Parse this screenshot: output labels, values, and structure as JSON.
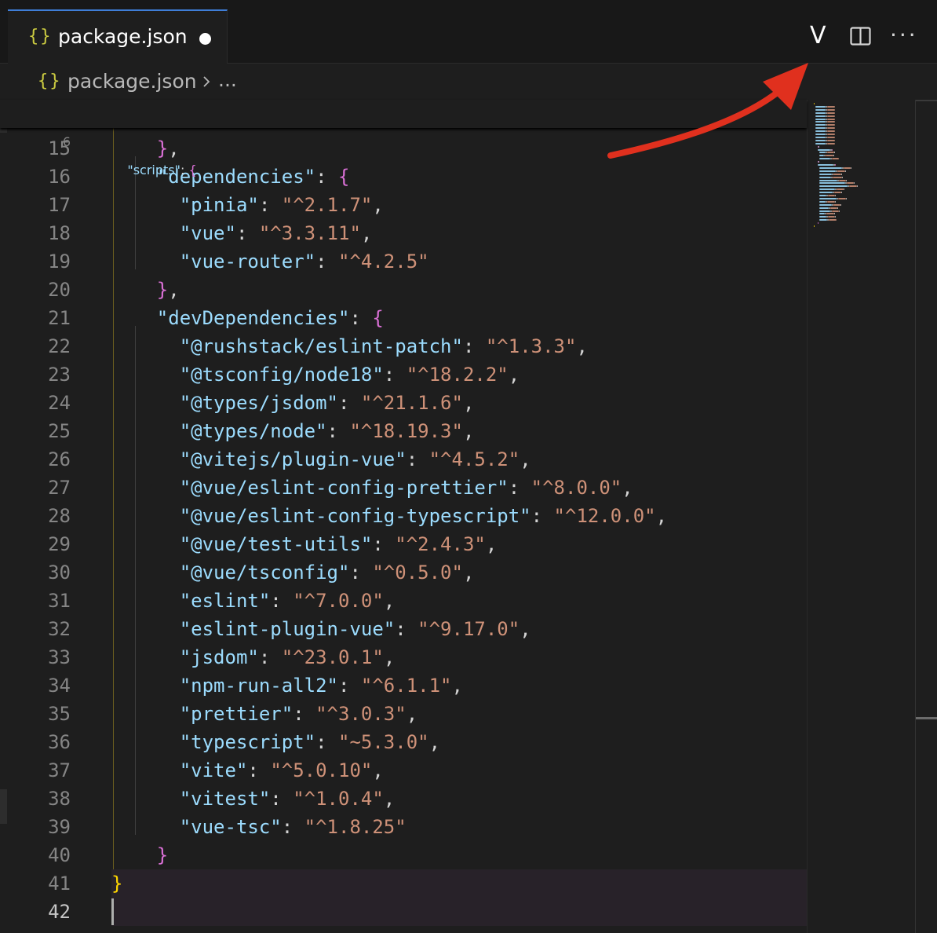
{
  "tab": {
    "icon": "{}",
    "label": "package.json",
    "dirty": true
  },
  "actions": {
    "v_label": "V",
    "split_icon": "split-editor-icon",
    "more_label": "···"
  },
  "breadcrumb": {
    "icon": "{}",
    "file": "package.json",
    "ellipsis": "..."
  },
  "colors": {
    "key": "#9cdcfe",
    "string": "#ce9178",
    "punct": "#d4d4d4",
    "bracket_level1": "#ffd700",
    "bracket_level2": "#da70d6",
    "bracket_level3": "#179fff",
    "annotation_arrow": "#e0301e",
    "tab_accent": "#3f7ed8"
  },
  "sticky_line": {
    "num": "6",
    "tokens": [
      {
        "t": "    ",
        "c": "p"
      },
      {
        "t": "\"scripts\"",
        "c": "k"
      },
      {
        "t": ": ",
        "c": "p"
      },
      {
        "t": "{",
        "c": "b2"
      }
    ]
  },
  "lines": [
    {
      "num": "15",
      "tokens": [
        {
          "t": "    ",
          "c": "p"
        },
        {
          "t": "}",
          "c": "b2"
        },
        {
          "t": ",",
          "c": "p"
        }
      ]
    },
    {
      "num": "16",
      "tokens": [
        {
          "t": "    ",
          "c": "p"
        },
        {
          "t": "\"dependencies\"",
          "c": "k"
        },
        {
          "t": ": ",
          "c": "p"
        },
        {
          "t": "{",
          "c": "b2"
        }
      ]
    },
    {
      "num": "17",
      "tokens": [
        {
          "t": "      ",
          "c": "p"
        },
        {
          "t": "\"pinia\"",
          "c": "k"
        },
        {
          "t": ": ",
          "c": "p"
        },
        {
          "t": "\"^2.1.7\"",
          "c": "s"
        },
        {
          "t": ",",
          "c": "p"
        }
      ]
    },
    {
      "num": "18",
      "tokens": [
        {
          "t": "      ",
          "c": "p"
        },
        {
          "t": "\"vue\"",
          "c": "k"
        },
        {
          "t": ": ",
          "c": "p"
        },
        {
          "t": "\"^3.3.11\"",
          "c": "s"
        },
        {
          "t": ",",
          "c": "p"
        }
      ]
    },
    {
      "num": "19",
      "tokens": [
        {
          "t": "      ",
          "c": "p"
        },
        {
          "t": "\"vue-router\"",
          "c": "k"
        },
        {
          "t": ": ",
          "c": "p"
        },
        {
          "t": "\"^4.2.5\"",
          "c": "s"
        }
      ]
    },
    {
      "num": "20",
      "tokens": [
        {
          "t": "    ",
          "c": "p"
        },
        {
          "t": "}",
          "c": "b2"
        },
        {
          "t": ",",
          "c": "p"
        }
      ]
    },
    {
      "num": "21",
      "tokens": [
        {
          "t": "    ",
          "c": "p"
        },
        {
          "t": "\"devDependencies\"",
          "c": "k"
        },
        {
          "t": ": ",
          "c": "p"
        },
        {
          "t": "{",
          "c": "b2"
        }
      ]
    },
    {
      "num": "22",
      "tokens": [
        {
          "t": "      ",
          "c": "p"
        },
        {
          "t": "\"@rushstack/eslint-patch\"",
          "c": "k"
        },
        {
          "t": ": ",
          "c": "p"
        },
        {
          "t": "\"^1.3.3\"",
          "c": "s"
        },
        {
          "t": ",",
          "c": "p"
        }
      ]
    },
    {
      "num": "23",
      "tokens": [
        {
          "t": "      ",
          "c": "p"
        },
        {
          "t": "\"@tsconfig/node18\"",
          "c": "k"
        },
        {
          "t": ": ",
          "c": "p"
        },
        {
          "t": "\"^18.2.2\"",
          "c": "s"
        },
        {
          "t": ",",
          "c": "p"
        }
      ]
    },
    {
      "num": "24",
      "tokens": [
        {
          "t": "      ",
          "c": "p"
        },
        {
          "t": "\"@types/jsdom\"",
          "c": "k"
        },
        {
          "t": ": ",
          "c": "p"
        },
        {
          "t": "\"^21.1.6\"",
          "c": "s"
        },
        {
          "t": ",",
          "c": "p"
        }
      ]
    },
    {
      "num": "25",
      "tokens": [
        {
          "t": "      ",
          "c": "p"
        },
        {
          "t": "\"@types/node\"",
          "c": "k"
        },
        {
          "t": ": ",
          "c": "p"
        },
        {
          "t": "\"^18.19.3\"",
          "c": "s"
        },
        {
          "t": ",",
          "c": "p"
        }
      ]
    },
    {
      "num": "26",
      "tokens": [
        {
          "t": "      ",
          "c": "p"
        },
        {
          "t": "\"@vitejs/plugin-vue\"",
          "c": "k"
        },
        {
          "t": ": ",
          "c": "p"
        },
        {
          "t": "\"^4.5.2\"",
          "c": "s"
        },
        {
          "t": ",",
          "c": "p"
        }
      ]
    },
    {
      "num": "27",
      "tokens": [
        {
          "t": "      ",
          "c": "p"
        },
        {
          "t": "\"@vue/eslint-config-prettier\"",
          "c": "k"
        },
        {
          "t": ": ",
          "c": "p"
        },
        {
          "t": "\"^8.0.0\"",
          "c": "s"
        },
        {
          "t": ",",
          "c": "p"
        }
      ]
    },
    {
      "num": "28",
      "tokens": [
        {
          "t": "      ",
          "c": "p"
        },
        {
          "t": "\"@vue/eslint-config-typescript\"",
          "c": "k"
        },
        {
          "t": ": ",
          "c": "p"
        },
        {
          "t": "\"^12.0.0\"",
          "c": "s"
        },
        {
          "t": ",",
          "c": "p"
        }
      ]
    },
    {
      "num": "29",
      "tokens": [
        {
          "t": "      ",
          "c": "p"
        },
        {
          "t": "\"@vue/test-utils\"",
          "c": "k"
        },
        {
          "t": ": ",
          "c": "p"
        },
        {
          "t": "\"^2.4.3\"",
          "c": "s"
        },
        {
          "t": ",",
          "c": "p"
        }
      ]
    },
    {
      "num": "30",
      "tokens": [
        {
          "t": "      ",
          "c": "p"
        },
        {
          "t": "\"@vue/tsconfig\"",
          "c": "k"
        },
        {
          "t": ": ",
          "c": "p"
        },
        {
          "t": "\"^0.5.0\"",
          "c": "s"
        },
        {
          "t": ",",
          "c": "p"
        }
      ]
    },
    {
      "num": "31",
      "tokens": [
        {
          "t": "      ",
          "c": "p"
        },
        {
          "t": "\"eslint\"",
          "c": "k"
        },
        {
          "t": ": ",
          "c": "p"
        },
        {
          "t": "\"^7.0.0\"",
          "c": "s"
        },
        {
          "t": ",",
          "c": "p"
        }
      ]
    },
    {
      "num": "32",
      "tokens": [
        {
          "t": "      ",
          "c": "p"
        },
        {
          "t": "\"eslint-plugin-vue\"",
          "c": "k"
        },
        {
          "t": ": ",
          "c": "p"
        },
        {
          "t": "\"^9.17.0\"",
          "c": "s"
        },
        {
          "t": ",",
          "c": "p"
        }
      ]
    },
    {
      "num": "33",
      "tokens": [
        {
          "t": "      ",
          "c": "p"
        },
        {
          "t": "\"jsdom\"",
          "c": "k"
        },
        {
          "t": ": ",
          "c": "p"
        },
        {
          "t": "\"^23.0.1\"",
          "c": "s"
        },
        {
          "t": ",",
          "c": "p"
        }
      ]
    },
    {
      "num": "34",
      "tokens": [
        {
          "t": "      ",
          "c": "p"
        },
        {
          "t": "\"npm-run-all2\"",
          "c": "k"
        },
        {
          "t": ": ",
          "c": "p"
        },
        {
          "t": "\"^6.1.1\"",
          "c": "s"
        },
        {
          "t": ",",
          "c": "p"
        }
      ]
    },
    {
      "num": "35",
      "tokens": [
        {
          "t": "      ",
          "c": "p"
        },
        {
          "t": "\"prettier\"",
          "c": "k"
        },
        {
          "t": ": ",
          "c": "p"
        },
        {
          "t": "\"^3.0.3\"",
          "c": "s"
        },
        {
          "t": ",",
          "c": "p"
        }
      ]
    },
    {
      "num": "36",
      "tokens": [
        {
          "t": "      ",
          "c": "p"
        },
        {
          "t": "\"typescript\"",
          "c": "k"
        },
        {
          "t": ": ",
          "c": "p"
        },
        {
          "t": "\"~5.3.0\"",
          "c": "s"
        },
        {
          "t": ",",
          "c": "p"
        }
      ]
    },
    {
      "num": "37",
      "tokens": [
        {
          "t": "      ",
          "c": "p"
        },
        {
          "t": "\"vite\"",
          "c": "k"
        },
        {
          "t": ": ",
          "c": "p"
        },
        {
          "t": "\"^5.0.10\"",
          "c": "s"
        },
        {
          "t": ",",
          "c": "p"
        }
      ]
    },
    {
      "num": "38",
      "tokens": [
        {
          "t": "      ",
          "c": "p"
        },
        {
          "t": "\"vitest\"",
          "c": "k"
        },
        {
          "t": ": ",
          "c": "p"
        },
        {
          "t": "\"^1.0.4\"",
          "c": "s"
        },
        {
          "t": ",",
          "c": "p"
        }
      ]
    },
    {
      "num": "39",
      "tokens": [
        {
          "t": "      ",
          "c": "p"
        },
        {
          "t": "\"vue-tsc\"",
          "c": "k"
        },
        {
          "t": ": ",
          "c": "p"
        },
        {
          "t": "\"^1.8.25\"",
          "c": "s"
        }
      ]
    },
    {
      "num": "40",
      "tokens": [
        {
          "t": "    ",
          "c": "p"
        },
        {
          "t": "}",
          "c": "b2"
        }
      ]
    },
    {
      "num": "41",
      "tokens": [
        {
          "t": "}",
          "c": "b1"
        }
      ]
    },
    {
      "num": "42",
      "tokens": []
    }
  ],
  "current_line": "42"
}
